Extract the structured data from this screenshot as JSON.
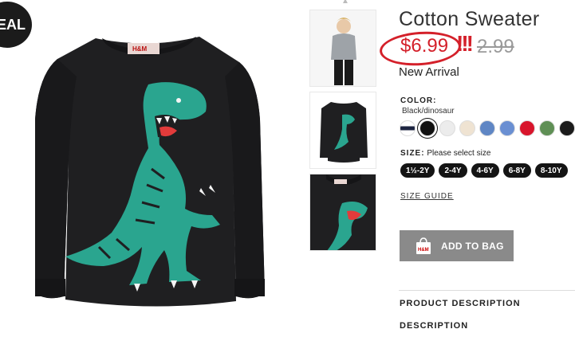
{
  "deal_badge": "EAL",
  "product": {
    "title": "Cotton Sweater",
    "sale_price": "$6.99",
    "annotation_marks": "!!!",
    "original_price": "2.99",
    "new_arrival": "New Arrival"
  },
  "color": {
    "label": "COLOR:",
    "selected_name": "Black/dinosaur",
    "swatches": [
      {
        "name": "navy-stripe",
        "color": "#1c2440"
      },
      {
        "name": "black",
        "color": "#111111"
      },
      {
        "name": "light-gray",
        "color": "#ececec"
      },
      {
        "name": "beige",
        "color": "#efe3d2"
      },
      {
        "name": "blue",
        "color": "#5f86c4"
      },
      {
        "name": "periwinkle",
        "color": "#6a8fd2"
      },
      {
        "name": "red",
        "color": "#d8152c"
      },
      {
        "name": "green",
        "color": "#5f8f55"
      },
      {
        "name": "black-2",
        "color": "#1b1b1b"
      }
    ]
  },
  "size": {
    "label": "SIZE:",
    "hint": "Please select size",
    "options": [
      "1½-2Y",
      "2-4Y",
      "4-6Y",
      "6-8Y",
      "8-10Y"
    ],
    "guide": "SIZE GUIDE"
  },
  "cta": {
    "add_to_bag": "ADD TO BAG",
    "bag_logo": "H&M"
  },
  "sections": {
    "product_description": "PRODUCT DESCRIPTION",
    "description": "DESCRIPTION"
  },
  "icons": {
    "bag": "shopping-bag-icon",
    "up": "chevron-up-icon"
  },
  "colors": {
    "accent_red": "#d4202a",
    "sweater": "#1d1d1f",
    "dino": "#2aa58f"
  }
}
